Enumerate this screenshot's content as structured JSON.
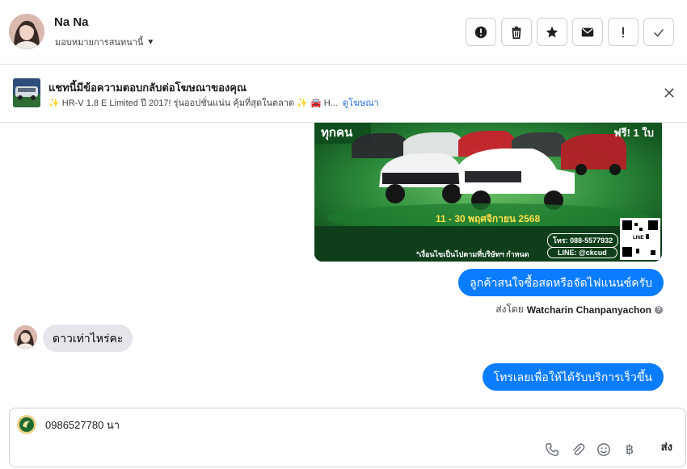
{
  "header": {
    "name": "Na Na",
    "assign_label": "มอบหมายการสนทนานี้",
    "actions": [
      {
        "icon": "alert-circle-icon"
      },
      {
        "icon": "trash-icon"
      },
      {
        "icon": "star-icon"
      },
      {
        "icon": "envelope-icon"
      },
      {
        "icon": "exclamation-icon"
      },
      {
        "icon": "checkmark-icon"
      }
    ]
  },
  "ad": {
    "title": "แชทนี้มีข้อความตอบกลับต่อโฆษณาของคุณ",
    "subtitle": "✨ HR-V 1.8 E Limited ปี 2017! รุ่นออปชั่นแน่น คุ้มที่สุดในตลาด ✨ 🚘 H...",
    "link": "ดูโฆษณา"
  },
  "promo": {
    "headline": "ทุกคน",
    "badge": "ฟรี! 1 ใบ",
    "dates": "11 - 30 พฤศจิกายน 2568",
    "phone": "โทร: 088-5577932",
    "line": "LINE: @ckcud",
    "footnote": "*เงื่อนไขเป็นไปตามที่บริษัทฯ กำหนด",
    "qr_label": "LINE"
  },
  "messages": {
    "out1": "ลูกค้าสนใจซื้อสดหรือจัดไฟแนนซ์ครับ",
    "sent_by_prefix": "ส่งโดย",
    "sent_by_name": "Watcharin Chanpanyachon",
    "in1": "ดาวเท่าไหร่คะ",
    "out2": "โทรเลยเพื่อให้ได้รับบริการเร็วขึ้น"
  },
  "composer": {
    "value": "0986527780 นา",
    "send_label": "ส่ง",
    "tools": [
      "phone-icon",
      "paperclip-icon",
      "emoji-icon",
      "baht-icon"
    ]
  },
  "colors": {
    "accent": "#0a7cff",
    "incoming_bubble": "#e4e6eb",
    "link": "#216fdb"
  }
}
